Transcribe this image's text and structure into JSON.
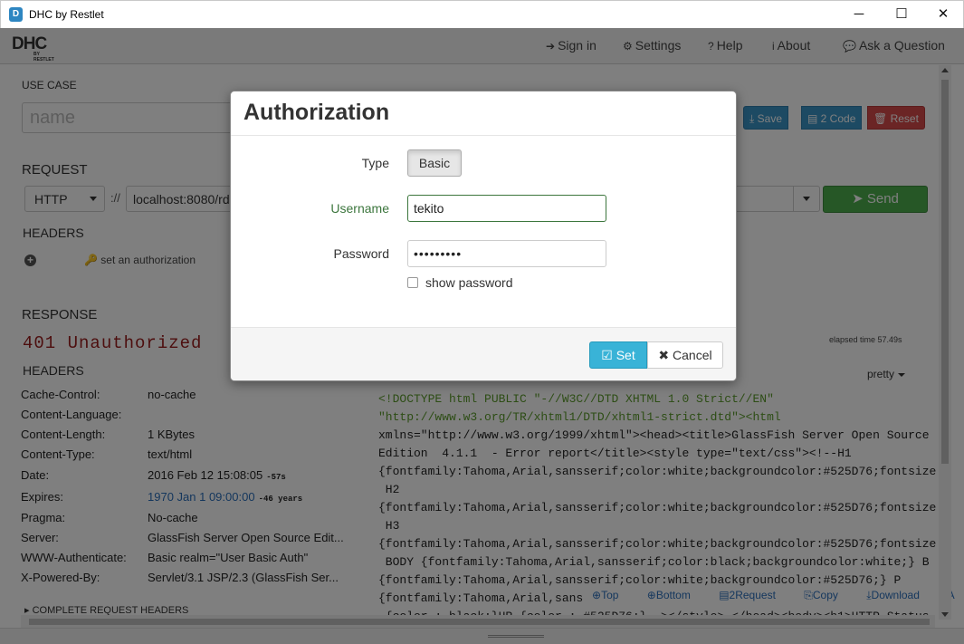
{
  "window": {
    "title": "DHC by Restlet",
    "minimize": "─",
    "maximize": "☐",
    "close": "✕"
  },
  "nav": {
    "logo": "DHC",
    "logo_sub": "BY RESTLET",
    "items": [
      {
        "label": "Sign in",
        "icon": "sign-in-icon",
        "glyph": "➔"
      },
      {
        "label": "Settings",
        "icon": "gear-icon",
        "glyph": "⚙"
      },
      {
        "label": "Help",
        "icon": "help-icon",
        "glyph": "?"
      },
      {
        "label": "About",
        "icon": "info-icon",
        "glyph": "i"
      },
      {
        "label": "Ask a Question",
        "icon": "chat-icon",
        "glyph": "💬"
      }
    ]
  },
  "use_case": {
    "label": "USE CASE",
    "name_placeholder": "name",
    "save": "Save",
    "code": "2 Code",
    "reset": "Reset"
  },
  "request": {
    "label": "REQUEST",
    "method": "HTTP",
    "protocol_sep": "://",
    "url": "localhost:8080/rd",
    "send": "Send",
    "headers_label": "HEADERS",
    "auth_link": "set an authorization"
  },
  "response": {
    "label": "RESPONSE",
    "status": "401 Unauthorized",
    "elapsed": "elapsed time 57.49s",
    "headers_label": "HEADERS",
    "format": "pretty",
    "headers": [
      {
        "key": "Cache-Control:",
        "value": "no-cache",
        "note": ""
      },
      {
        "key": "Content-Language:",
        "value": "",
        "note": ""
      },
      {
        "key": "Content-Length:",
        "value": "1 KBytes",
        "note": ""
      },
      {
        "key": "Content-Type:",
        "value": "text/html",
        "note": ""
      },
      {
        "key": "Date:",
        "value": "2016 Feb 12 15:08:05",
        "note": "-57s"
      },
      {
        "key": "Expires:",
        "value": "1970 Jan 1 09:00:00",
        "note": "-46 years",
        "link": true
      },
      {
        "key": "Pragma:",
        "value": "No-cache",
        "note": ""
      },
      {
        "key": "Server:",
        "value": "GlassFish Server Open Source Edit...",
        "note": ""
      },
      {
        "key": "WWW-Authenticate:",
        "value": "Basic realm=\"User Basic Auth\"",
        "note": ""
      },
      {
        "key": "X-Powered-By:",
        "value": "Servlet/3.1 JSP/2.3 (GlassFish Ser...",
        "note": ""
      }
    ],
    "complete_request_headers": "COMPLETE REQUEST HEADERS",
    "body_lines": [
      "<!DOCTYPE html PUBLIC \"-//W3C//DTD XHTML 1.0 Strict//EN\"",
      "\"http://www.w3.org/TR/xhtml1/DTD/xhtml1-strict.dtd\"><html",
      "xmlns=\"http://www.w3.org/1999/xhtml\"><head><title>GlassFish Server Open Source",
      "Edition  4.1.1  - Error report</title><style type=\"text/css\"><!--H1",
      "{fontfamily:Tahoma,Arial,sansserif;color:white;backgroundcolor:#525D76;fontsize:",
      " H2",
      "{fontfamily:Tahoma,Arial,sansserif;color:white;backgroundcolor:#525D76;fontsize:",
      " H3",
      "{fontfamily:Tahoma,Arial,sansserif;color:white;backgroundcolor:#525D76;fontsize:",
      " BODY {fontfamily:Tahoma,Arial,sansserif;color:black;backgroundcolor:white;} B",
      "{fontfamily:Tahoma,Arial,sansserif;color:white;backgroundcolor:#525D76;} P",
      "{fontfamily:Tahoma,Arial,sans",
      " {color : black;}HR {color : #525D76;}--></style> </head><body><h1>HTTP Status"
    ],
    "toolbar": {
      "top": "Top",
      "bottom": "Bottom",
      "request": "2Request",
      "copy": "Copy",
      "download": "Download",
      "more": "A"
    }
  },
  "modal": {
    "title": "Authorization",
    "type_label": "Type",
    "type_value": "Basic",
    "username_label": "Username",
    "username_value": "tekito",
    "password_label": "Password",
    "password_value": "•••••••••",
    "show_password": "show password",
    "set": "Set",
    "cancel": "Cancel"
  },
  "colors": {
    "accent": "#39b3d7",
    "send": "#4cae4c",
    "reset": "#d64b4b",
    "status_error": "#9b1c1c",
    "valid_field": "#3c763d"
  }
}
